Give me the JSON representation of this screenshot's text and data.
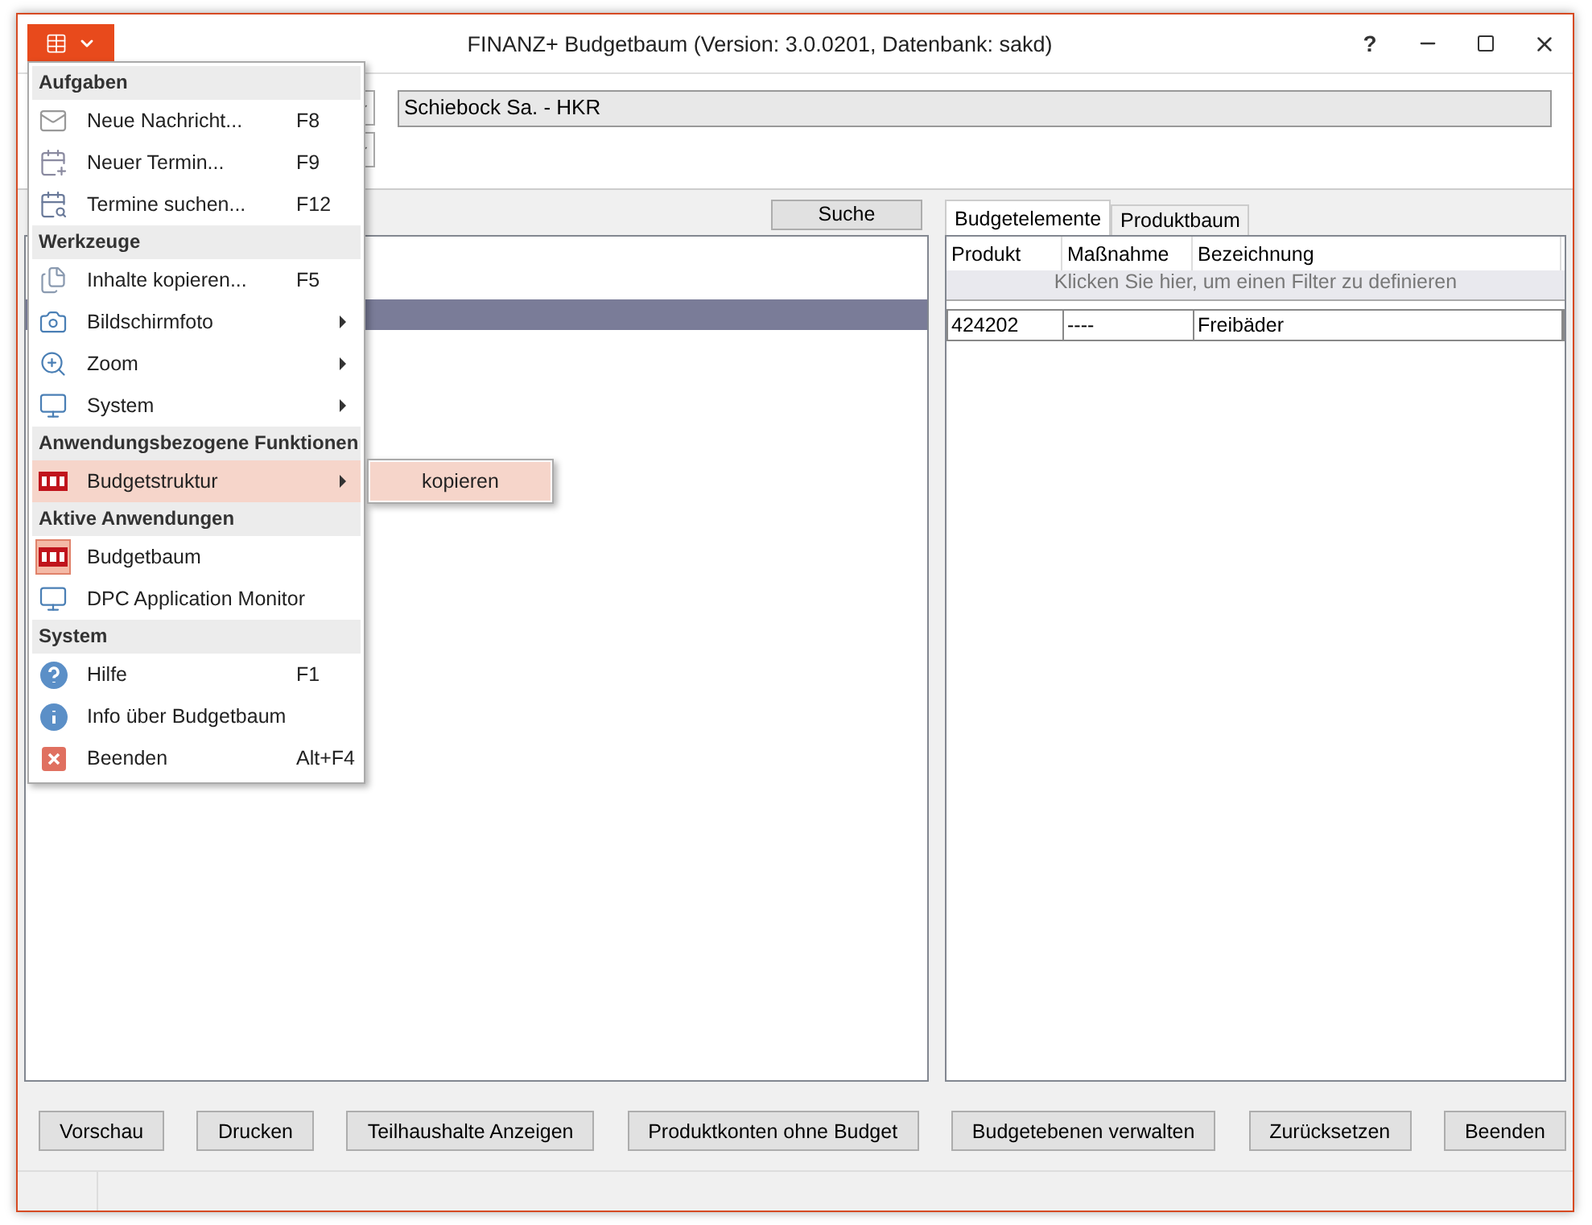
{
  "window": {
    "title": "FINANZ+ Budgetbaum (Version: 3.0.0201, Datenbank: sakd)",
    "help": "?"
  },
  "header": {
    "field_value": "Schiebock Sa. - HKR"
  },
  "left_panel": {
    "search_button": "Suche",
    "rows": [
      {
        "selected": false
      },
      {
        "selected": true
      }
    ]
  },
  "right_panel": {
    "tabs": [
      {
        "label": "Budgetelemente",
        "selected": true
      },
      {
        "label": "Produktbaum",
        "selected": false
      }
    ],
    "columns": [
      "Produkt",
      "Maßnahme",
      "Bezeichnung"
    ],
    "filter_placeholder": "Klicken Sie hier, um einen Filter zu definieren",
    "rows": [
      {
        "cells": [
          "424202",
          "----",
          "Freibäder"
        ]
      }
    ]
  },
  "buttons": [
    "Vorschau",
    "Drucken",
    "Teilhaushalte Anzeigen",
    "Produktkonten ohne Budget",
    "Budgetebenen verwalten",
    "Zurücksetzen",
    "Beenden"
  ],
  "menu": {
    "sections": [
      {
        "header": "Aufgaben",
        "items": [
          {
            "kind": "mail",
            "label": "Neue Nachricht...",
            "shortcut": "F8",
            "submenu": false,
            "selected": false,
            "current": false
          },
          {
            "kind": "calendar",
            "label": "Neuer Termin...",
            "shortcut": "F9",
            "submenu": false,
            "selected": false,
            "current": false
          },
          {
            "kind": "calendar-search",
            "label": "Termine suchen...",
            "shortcut": "F12",
            "submenu": false,
            "selected": false,
            "current": false
          }
        ]
      },
      {
        "header": "Werkzeuge",
        "items": [
          {
            "kind": "copy",
            "label": "Inhalte kopieren...",
            "shortcut": "F5",
            "submenu": false,
            "selected": false,
            "current": false
          },
          {
            "kind": "camera",
            "label": "Bildschirmfoto",
            "submenu": true,
            "selected": false,
            "current": false
          },
          {
            "kind": "zoom",
            "label": "Zoom",
            "submenu": true,
            "selected": false,
            "current": false
          },
          {
            "kind": "monitor",
            "label": "System",
            "submenu": true,
            "selected": false,
            "current": false
          }
        ]
      },
      {
        "header": "Anwendungsbezogene Funktionen",
        "items": [
          {
            "kind": "logo",
            "label": "Budgetstruktur",
            "submenu": true,
            "selected": true,
            "current": false
          }
        ]
      },
      {
        "header": "Aktive Anwendungen",
        "items": [
          {
            "kind": "logo",
            "label": "Budgetbaum",
            "submenu": false,
            "selected": false,
            "current": true
          },
          {
            "kind": "monitor",
            "label": "DPC Application Monitor",
            "submenu": false,
            "selected": false,
            "current": false
          }
        ]
      },
      {
        "header": "System",
        "items": [
          {
            "kind": "help",
            "label": "Hilfe",
            "shortcut": "F1",
            "submenu": false,
            "selected": false,
            "current": false
          },
          {
            "kind": "info",
            "label": "Info über Budgetbaum",
            "submenu": false,
            "selected": false,
            "current": false
          },
          {
            "kind": "exit",
            "label": "Beenden",
            "shortcut": "Alt+F4",
            "submenu": false,
            "selected": false,
            "current": false
          }
        ]
      }
    ],
    "submenu": {
      "items": [
        "kopieren"
      ]
    }
  }
}
